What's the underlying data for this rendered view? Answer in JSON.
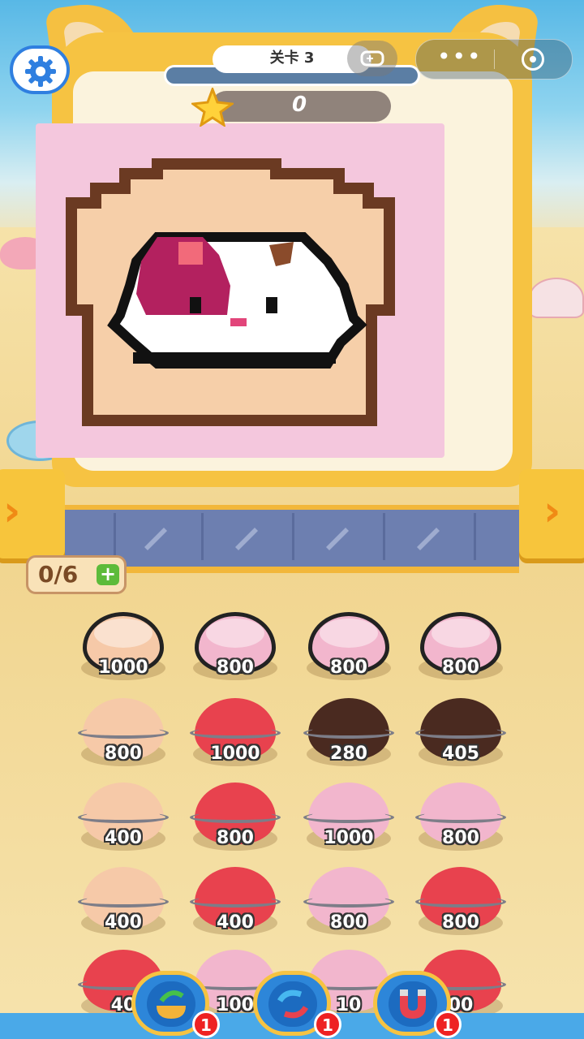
{
  "header": {
    "level_label": "关卡 3",
    "score": "0"
  },
  "counter": {
    "value": "0/6",
    "plus": "+"
  },
  "buckets": [
    {
      "value": "1000",
      "color": "#f6c9a8",
      "open": true
    },
    {
      "value": "800",
      "color": "#f2b6cd",
      "open": true
    },
    {
      "value": "800",
      "color": "#f2b6cd",
      "open": true
    },
    {
      "value": "800",
      "color": "#f2b6cd",
      "open": true
    },
    {
      "value": "800",
      "color": "#f6c9a8",
      "open": false
    },
    {
      "value": "1000",
      "color": "#e8424e",
      "open": false
    },
    {
      "value": "280",
      "color": "#4a2a20",
      "open": false
    },
    {
      "value": "405",
      "color": "#4a2a20",
      "open": false
    },
    {
      "value": "400",
      "color": "#f6c9a8",
      "open": false
    },
    {
      "value": "800",
      "color": "#e8424e",
      "open": false
    },
    {
      "value": "1000",
      "color": "#f2b6cd",
      "open": false
    },
    {
      "value": "800",
      "color": "#f2b6cd",
      "open": false
    },
    {
      "value": "400",
      "color": "#f6c9a8",
      "open": false
    },
    {
      "value": "400",
      "color": "#e8424e",
      "open": false
    },
    {
      "value": "800",
      "color": "#f2b6cd",
      "open": false
    },
    {
      "value": "800",
      "color": "#e8424e",
      "open": false
    },
    {
      "value": "40",
      "color": "#e8424e",
      "open": false
    },
    {
      "value": "100",
      "color": "#f2b6cd",
      "open": false
    },
    {
      "value": "10",
      "color": "#f2b6cd",
      "open": false
    },
    {
      "value": "00",
      "color": "#e8424e",
      "open": false
    }
  ],
  "tools": [
    {
      "name": "refill-tool",
      "count": "1"
    },
    {
      "name": "shuffle-tool",
      "count": "1"
    },
    {
      "name": "magnet-tool",
      "count": "1"
    }
  ],
  "colors": {
    "board": "#f6c342",
    "canvas": "#f4c7dd",
    "bread": "#f6cfa9",
    "outline": "#6b3a22",
    "accent": "#b3215f"
  },
  "progress": 0.0
}
